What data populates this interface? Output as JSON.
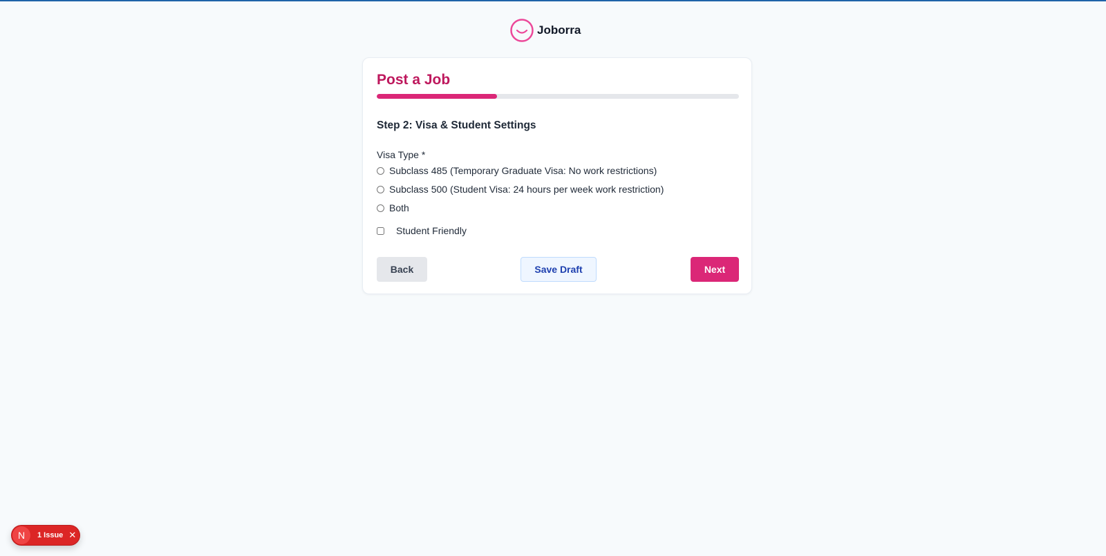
{
  "brand": {
    "name": "Joborra",
    "logo_icon": "smile-face-icon",
    "logo_color": "#ec4899"
  },
  "form": {
    "title": "Post a Job",
    "progress_percent": 33.3,
    "step_heading": "Step 2: Visa & Student Settings",
    "visa_type_label": "Visa Type *",
    "visa_options": [
      {
        "label": "Subclass 485 (Temporary Graduate Visa: No work restrictions)",
        "checked": false
      },
      {
        "label": "Subclass 500 (Student Visa: 24 hours per week work restriction)",
        "checked": false
      },
      {
        "label": "Both",
        "checked": false
      }
    ],
    "student_friendly_label": "Student Friendly",
    "student_friendly_checked": false
  },
  "actions": {
    "back_label": "Back",
    "save_draft_label": "Save Draft",
    "next_label": "Next"
  },
  "dev_overlay": {
    "avatar_letter": "N",
    "issue_text": "1 Issue",
    "close_glyph": "✕"
  },
  "colors": {
    "accent": "#db2777",
    "title": "#be185d",
    "save_draft_text": "#1e40af",
    "issue_badge": "#dc2626"
  }
}
